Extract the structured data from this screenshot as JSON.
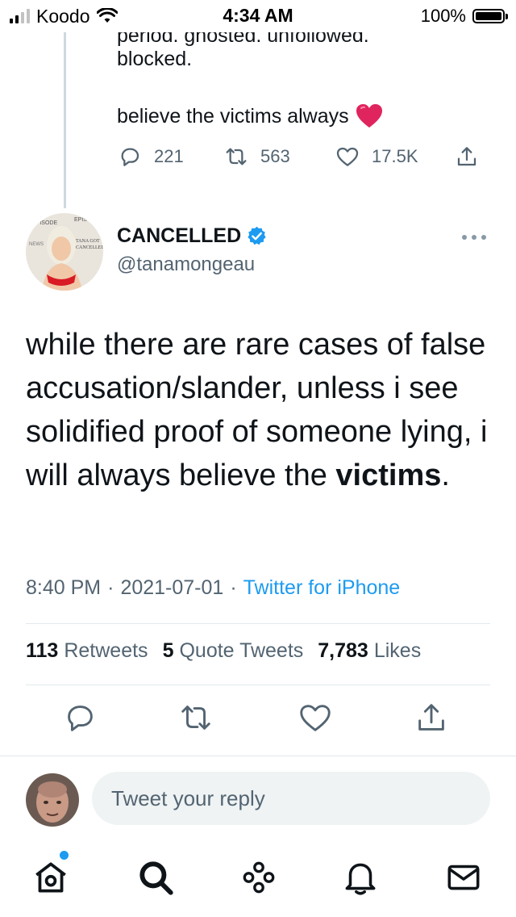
{
  "status_bar": {
    "carrier": "Koodo",
    "time": "4:34 AM",
    "battery": "100%"
  },
  "previous_tweet": {
    "cut_text": "period. ghosted. unfollowed.",
    "text_line": "blocked.",
    "text_line2": "believe the victims always",
    "emoji": "❤️",
    "replies": "221",
    "retweets": "563",
    "likes": "17.5K"
  },
  "tweet": {
    "display_name": "CANCELLED",
    "handle": "@tanamongeau",
    "text_before": "while there are rare cases of false accusation/slander, unless i see solidified proof of someone lying, i will always believe the ",
    "text_bold": "victims",
    "text_after": ".",
    "time": "8:40 PM",
    "date": "2021-07-01",
    "separator": "·",
    "source": "Twitter for iPhone",
    "stats": {
      "retweets_count": "113",
      "retweets_label": "Retweets",
      "quotes_count": "5",
      "quotes_label": "Quote Tweets",
      "likes_count": "7,783",
      "likes_label": "Likes"
    }
  },
  "reply": {
    "placeholder": "Tweet your reply"
  },
  "icons": {
    "verified": "verified-badge-icon",
    "more": "more-icon",
    "reply": "reply-icon",
    "retweet": "retweet-icon",
    "like": "heart-icon",
    "share": "share-icon",
    "home": "home-icon",
    "search": "search-icon",
    "spaces": "spaces-icon",
    "notifications": "bell-icon",
    "messages": "mail-icon"
  },
  "colors": {
    "accent": "#1d9bf0",
    "text": "#0f1419",
    "secondary": "#536471",
    "heart": "#e0245e"
  }
}
